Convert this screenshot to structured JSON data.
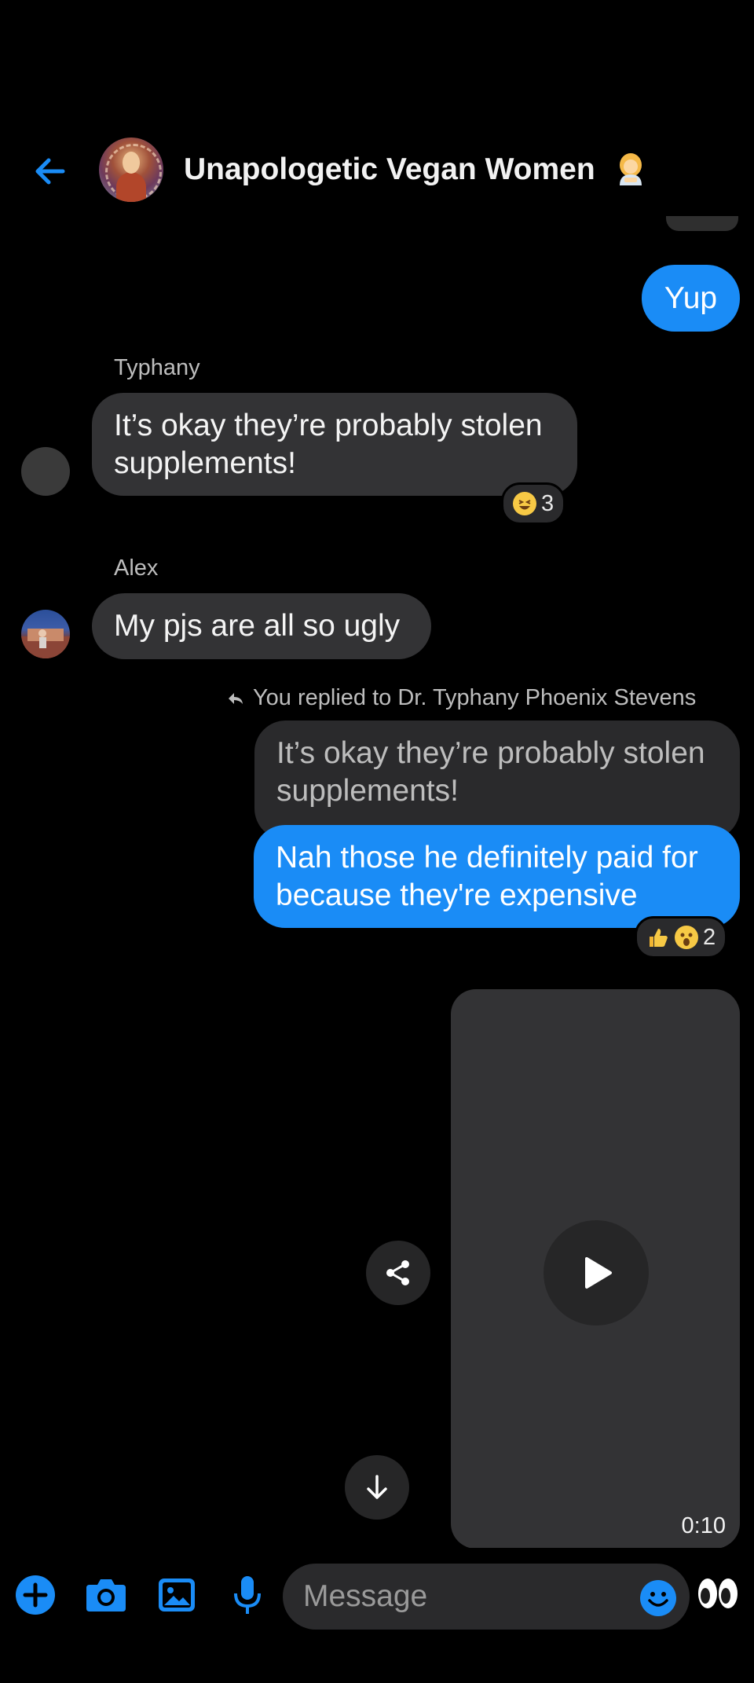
{
  "header": {
    "title": "Unapologetic Vegan Women"
  },
  "messages": {
    "yup": "Yup",
    "typhany_sender": "Typhany",
    "typhany_text": "It’s okay they’re probably stolen supplements!",
    "typhany_reaction_count": "3",
    "alex_sender": "Alex",
    "alex_text": "My pjs are all so ugly",
    "reply_label": "You replied to Dr. Typhany Phoenix Stevens",
    "quoted_text": "It’s okay they’re probably stolen supplements!",
    "reply_text": "Nah those he definitely paid for because they're expensive",
    "reply_reaction_count": "2",
    "video_duration": "0:10"
  },
  "composer": {
    "placeholder": "Message"
  },
  "colors": {
    "accent": "#1a8cf6",
    "bubble_gray": "#333335",
    "background": "#000000"
  },
  "icons": [
    "back-arrow-icon",
    "plus-icon",
    "camera-icon",
    "gallery-icon",
    "microphone-icon",
    "emoji-icon",
    "eyes-emoji-icon",
    "play-icon",
    "share-icon",
    "arrow-down-icon"
  ]
}
